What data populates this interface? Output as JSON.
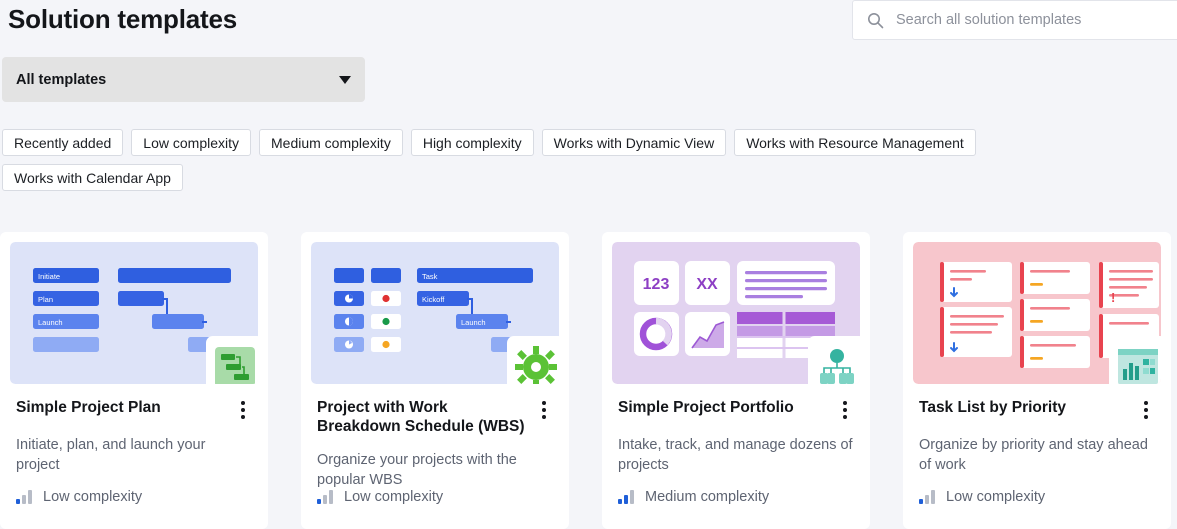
{
  "header": {
    "title": "Solution templates",
    "search": {
      "placeholder": "Search all solution templates",
      "value": "",
      "icon": "search-icon"
    }
  },
  "filter_dropdown": {
    "selected": "All templates",
    "icon": "chevron-down-icon",
    "options": [
      "All templates"
    ]
  },
  "filter_chips": [
    {
      "label": "Recently added"
    },
    {
      "label": "Low complexity"
    },
    {
      "label": "Medium complexity"
    },
    {
      "label": "High complexity"
    },
    {
      "label": "Works with Dynamic View"
    },
    {
      "label": "Works with Resource Management"
    },
    {
      "label": "Works with Calendar App"
    }
  ],
  "cards": [
    {
      "title": "Simple Project Plan",
      "description": "Initiate, plan, and launch your project",
      "complexity": "Low complexity",
      "complexity_level": 1,
      "menu_icon": "kebab-menu-icon",
      "thumbnail": {
        "theme": "blue",
        "bg": "#dde3f8",
        "bar_labels": [
          "Initiate",
          "Plan",
          "Launch"
        ],
        "overlay_icon": "workflow-green-icon"
      }
    },
    {
      "title": "Project with Work Breakdown Schedule (WBS)",
      "description": "Organize your projects with the popular WBS",
      "complexity": "Low complexity",
      "complexity_level": 1,
      "menu_icon": "kebab-menu-icon",
      "thumbnail": {
        "theme": "blue",
        "bg": "#dde3f8",
        "bar_labels": [
          "Task",
          "Kickoff",
          "Launch"
        ],
        "status_dots": [
          "#e03131",
          "#199a4a",
          "#f5a623"
        ],
        "overlay_icon": "gear-green-icon"
      }
    },
    {
      "title": "Simple Project Portfolio",
      "description": "Intake, track, and manage dozens of projects",
      "complexity": "Medium complexity",
      "complexity_level": 2,
      "menu_icon": "kebab-menu-icon",
      "thumbnail": {
        "theme": "purple",
        "bg": "#e2d3f0",
        "tile_labels": [
          "123",
          "XX"
        ],
        "overlay_icon": "org-chart-teal-icon"
      }
    },
    {
      "title": "Task List by Priority",
      "description": "Organize by priority and stay ahead of work",
      "complexity": "Low complexity",
      "complexity_level": 1,
      "menu_icon": "kebab-menu-icon",
      "thumbnail": {
        "theme": "pink",
        "bg": "#f7c6cc",
        "marks": [
          "down-arrow",
          "exclamation"
        ],
        "overlay_icon": "bar-chart-teal-icon"
      }
    }
  ],
  "colors": {
    "page_bg": "#f4f5f9",
    "card_bg": "#ffffff",
    "accent_blue": "#1f5fd8",
    "text_primary": "#14161a",
    "text_secondary": "#5e6472"
  }
}
